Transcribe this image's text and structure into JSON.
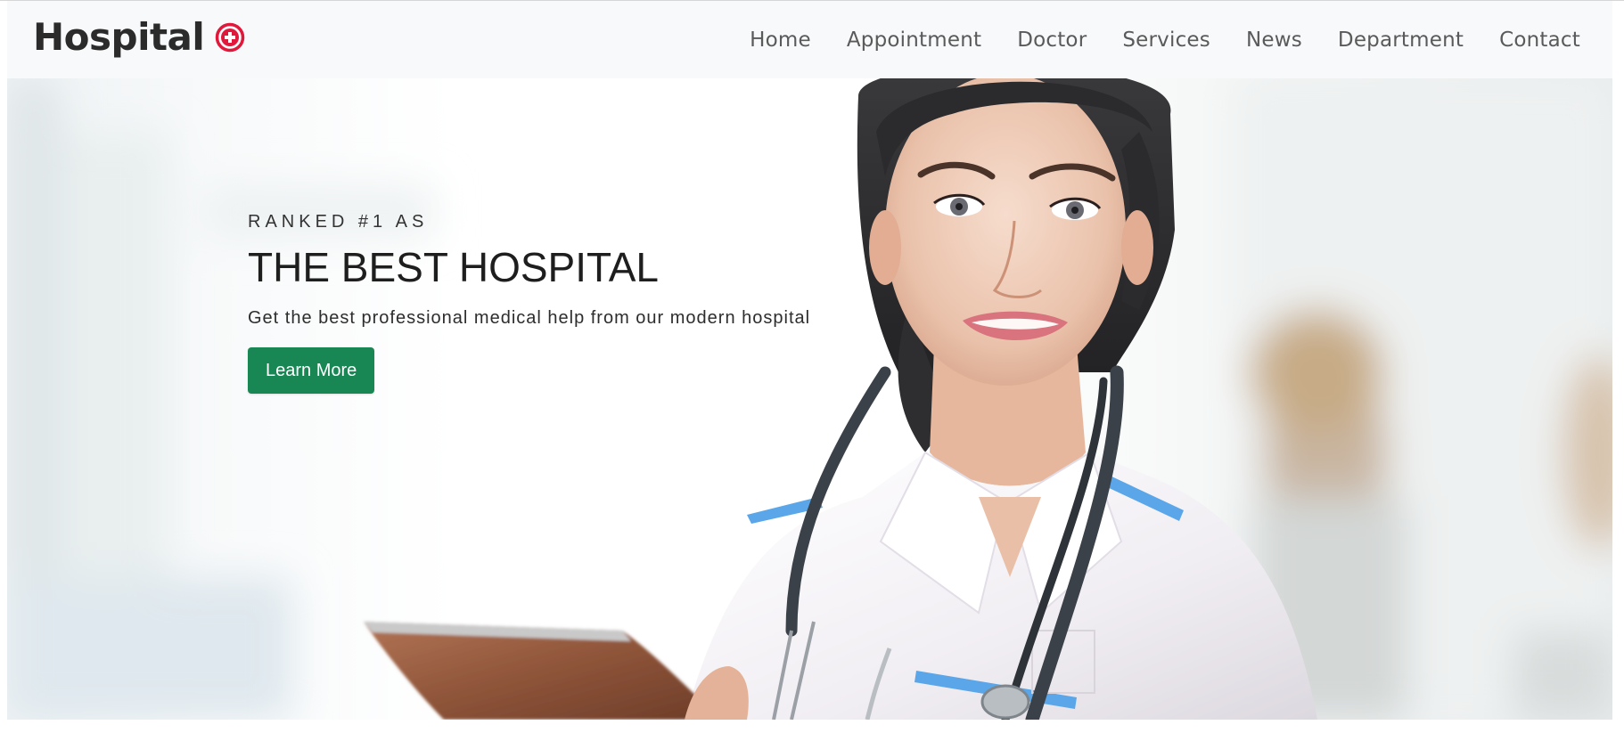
{
  "brand": {
    "name": "Hospital",
    "icon": "medical-cross-icon",
    "icon_color": "#e0183b"
  },
  "nav": {
    "items": [
      {
        "label": "Home"
      },
      {
        "label": "Appointment"
      },
      {
        "label": "Doctor"
      },
      {
        "label": "Services"
      },
      {
        "label": "News"
      },
      {
        "label": "Department"
      },
      {
        "label": "Contact"
      }
    ]
  },
  "hero": {
    "kicker": "RANKED #1 AS",
    "headline": "THE BEST HOSPITAL",
    "subline": "Get the best professional medical help from our modern hospital",
    "cta_label": "Learn More",
    "cta_color": "#198754",
    "image": "doctor-with-stethoscope-and-tablet"
  }
}
